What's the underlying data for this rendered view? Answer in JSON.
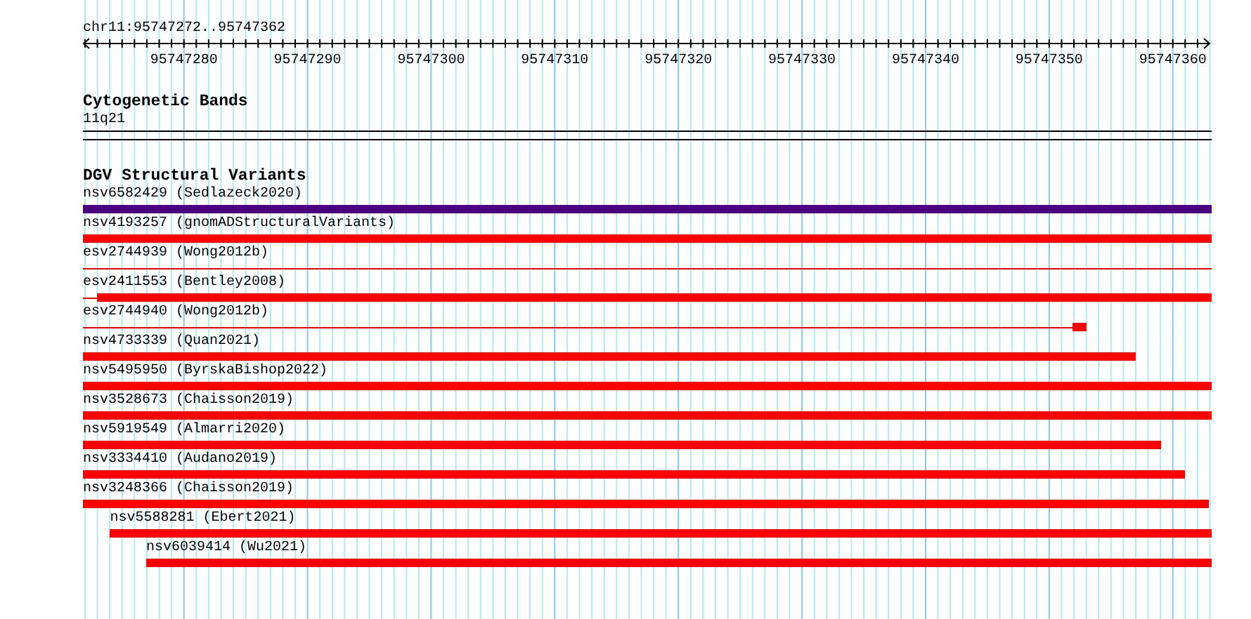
{
  "ruler": {
    "location": "chr11:95747272..95747362",
    "ticks": [
      "95747280",
      "95747290",
      "95747300",
      "95747310",
      "95747320",
      "95747330",
      "95747340",
      "95747350",
      "95747360"
    ]
  },
  "cytogenetic_bands": {
    "title": "Cytogenetic Bands",
    "band": "11q21"
  },
  "variants_track": {
    "title": "DGV Structural Variants",
    "features": [
      {
        "label": "nsv6582429 (Sedlazeck2020)",
        "color": "#4b0082",
        "kind": "bar",
        "level": 1
      },
      {
        "label": "nsv4193257 (gnomADStructuralVariants)",
        "color": "#ff0000",
        "kind": "bar",
        "level": 1
      },
      {
        "label": "esv2744939 (Wong2012b)",
        "color": "#ff0000",
        "kind": "line",
        "level": 1
      },
      {
        "label": "esv2411553 (Bentley2008)",
        "color": "#ff0000",
        "kind": "stub",
        "level": 0.9875
      },
      {
        "label": "esv2744940 (Wong2012b)",
        "color": "#ff0000",
        "kind": "block",
        "level": 0.877
      },
      {
        "label": "nsv4733339 (Quan2021)",
        "color": "#ff0000",
        "kind": "bar",
        "level": 0.933
      },
      {
        "label": "nsv5495950 (ByrskaBishop2022)",
        "color": "#ff0000",
        "kind": "bar",
        "level": 1
      },
      {
        "label": "nsv3528673 (Chaisson2019)",
        "color": "#ff0000",
        "kind": "bar",
        "level": 1
      },
      {
        "label": "nsv5919549 (Almarri2020)",
        "color": "#ff0000",
        "kind": "bar",
        "level": 0.955
      },
      {
        "label": "nsv3334410 (Audano2019)",
        "color": "#ff0000",
        "kind": "bar",
        "level": 0.976
      },
      {
        "label": "nsv3248366 (Chaisson2019)",
        "color": "#ff0000",
        "kind": "bar",
        "level": 0.997
      },
      {
        "label": "nsv5588281 (Ebert2021)",
        "color": "#ff0000",
        "kind": "inset",
        "level": 0.976
      },
      {
        "label": "nsv6039414 (Wu2021)",
        "color": "#ff0000",
        "kind": "inset",
        "level": 0.944
      }
    ]
  }
}
